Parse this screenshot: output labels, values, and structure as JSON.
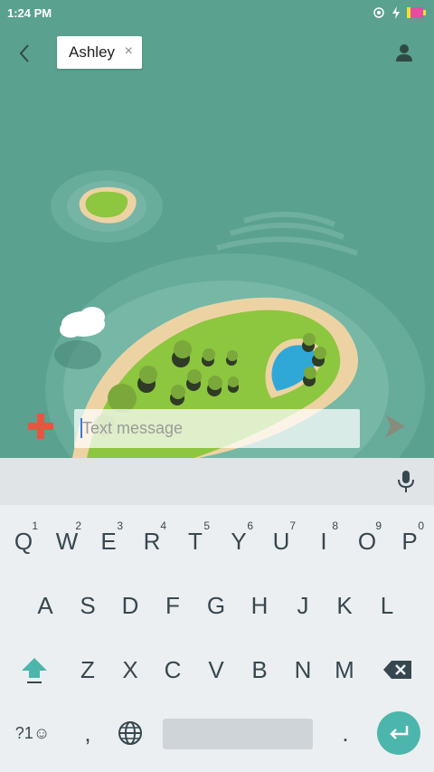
{
  "status_bar": {
    "time": "1:24 PM"
  },
  "header": {
    "recipient": "Ashley",
    "chip_close": "×"
  },
  "compose": {
    "placeholder": "Text message"
  },
  "keyboard": {
    "row1": [
      {
        "key": "Q",
        "hint": "1"
      },
      {
        "key": "W",
        "hint": "2"
      },
      {
        "key": "E",
        "hint": "3"
      },
      {
        "key": "R",
        "hint": "4"
      },
      {
        "key": "T",
        "hint": "5"
      },
      {
        "key": "Y",
        "hint": "6"
      },
      {
        "key": "U",
        "hint": "7"
      },
      {
        "key": "I",
        "hint": "8"
      },
      {
        "key": "O",
        "hint": "9"
      },
      {
        "key": "P",
        "hint": "0"
      }
    ],
    "row2": [
      "A",
      "S",
      "D",
      "F",
      "G",
      "H",
      "J",
      "K",
      "L"
    ],
    "row3": [
      "Z",
      "X",
      "C",
      "V",
      "B",
      "N",
      "M"
    ],
    "symbols_label": "?1☺",
    "comma": ",",
    "period": "."
  },
  "colors": {
    "accent": "#4db6ac",
    "plus": "#e8553f",
    "send": "#8a8a7a",
    "sea": "#5aa18f"
  }
}
